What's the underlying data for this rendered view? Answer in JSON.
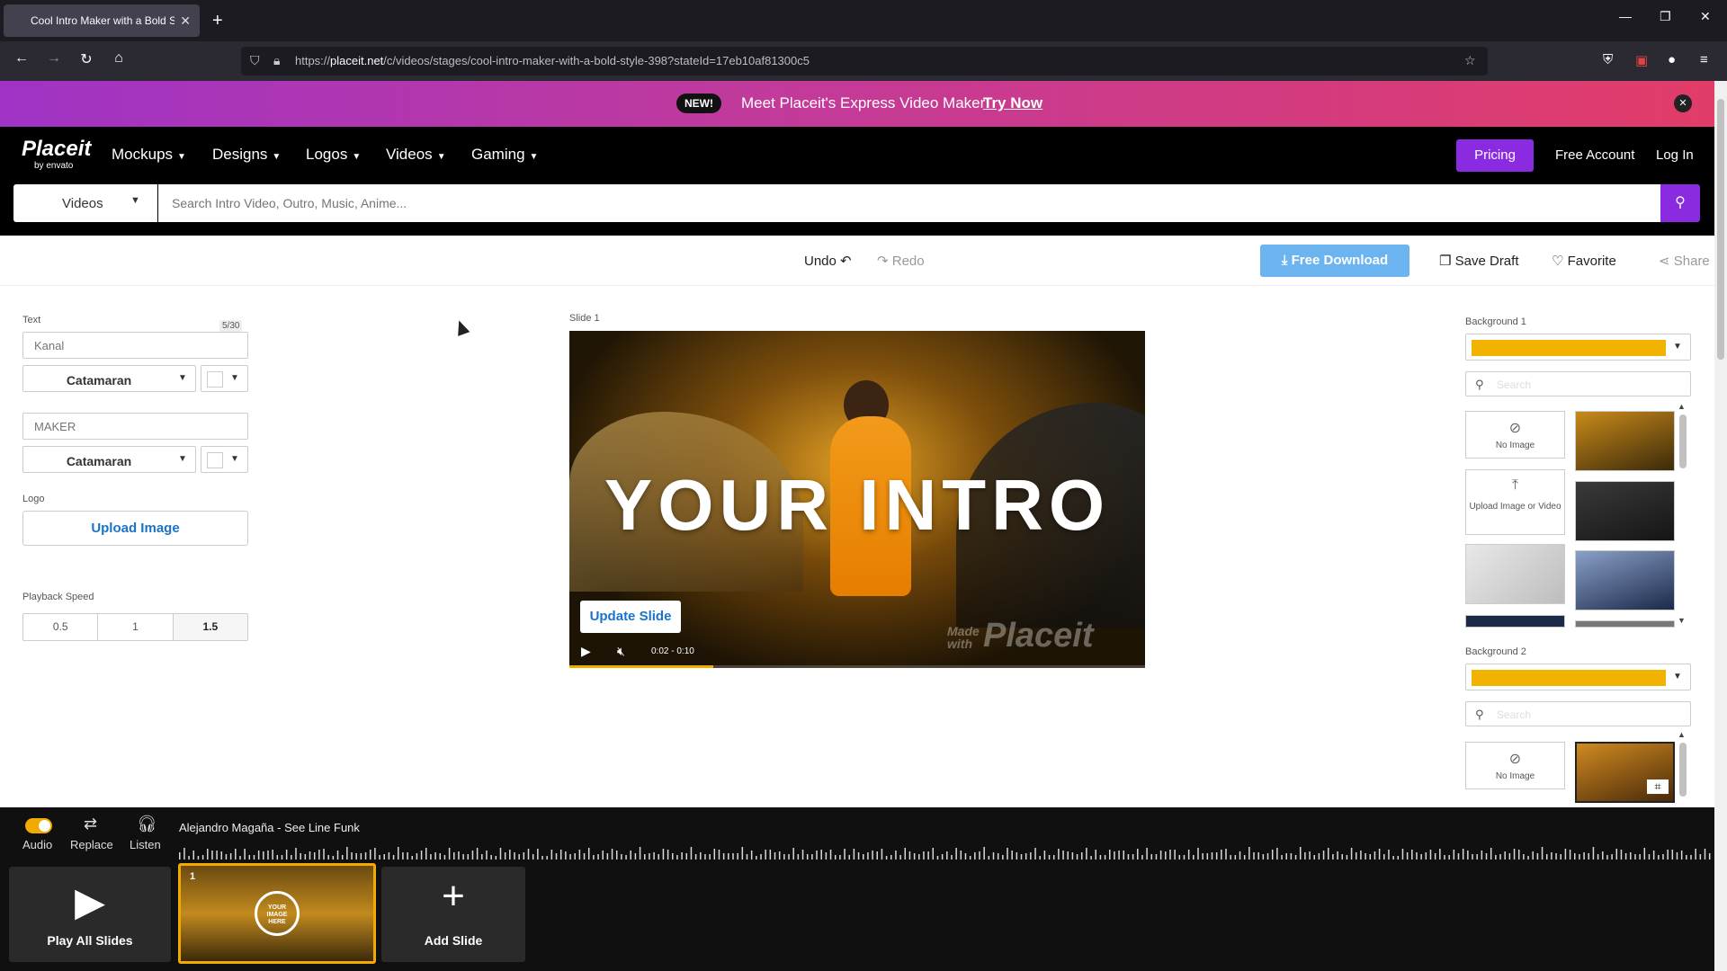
{
  "browser": {
    "tab_title": "Cool Intro Maker with a Bold St",
    "url_prefix": "https://",
    "url_host": "placeit.net",
    "url_path": "/c/videos/stages/cool-intro-maker-with-a-bold-style-398?stateId=17eb10af81300c5"
  },
  "promo": {
    "badge": "NEW!",
    "text": "Meet Placeit's Express Video Maker!",
    "link": "Try Now"
  },
  "site": {
    "logo_main": "Placeit",
    "logo_sub": "by envato",
    "menu": [
      "Mockups",
      "Designs",
      "Logos",
      "Videos",
      "Gaming"
    ],
    "pricing": "Pricing",
    "free_account": "Free Account",
    "login": "Log In",
    "search_category": "Videos",
    "search_placeholder": "Search Intro Video, Outro, Music, Anime..."
  },
  "toolbar": {
    "undo": "Undo",
    "redo": "Redo",
    "free_download": "Free Download",
    "save_draft": "Save Draft",
    "favorite": "Favorite",
    "share": "Share"
  },
  "left": {
    "text_label": "Text",
    "counter": "5/30",
    "text1_placeholder": "Kanal",
    "font1": "Catamaran",
    "text2_placeholder": "MAKER",
    "font2": "Catamaran",
    "logo_label": "Logo",
    "upload_image": "Upload Image",
    "playback_label": "Playback Speed",
    "speeds": [
      "0.5",
      "1",
      "1.5"
    ]
  },
  "preview": {
    "slide_label": "Slide 1",
    "headline": "YOUR INTRO",
    "watermark_small": "Made with",
    "watermark": "Placeit",
    "update_slide": "Update Slide",
    "time": "0:02 - 0:10",
    "progress_fraction": 0.25
  },
  "right": {
    "bg1_label": "Background 1",
    "bg2_label": "Background 2",
    "search_placeholder": "Search",
    "no_image": "No Image",
    "upload_image_or_video": "Upload Image or Video"
  },
  "bottom": {
    "audio": "Audio",
    "replace": "Replace",
    "listen": "Listen",
    "track": "Alejandro Magaña - See Line Funk",
    "play_all": "Play All Slides",
    "slide_number": "1",
    "thumb_text": "YOUR IMAGE HERE",
    "add_slide": "Add Slide"
  },
  "colors": {
    "accent": "#8a2be2",
    "background_swatch": "#f2b200",
    "download": "#6bb4f0",
    "link": "#1a73c8"
  }
}
